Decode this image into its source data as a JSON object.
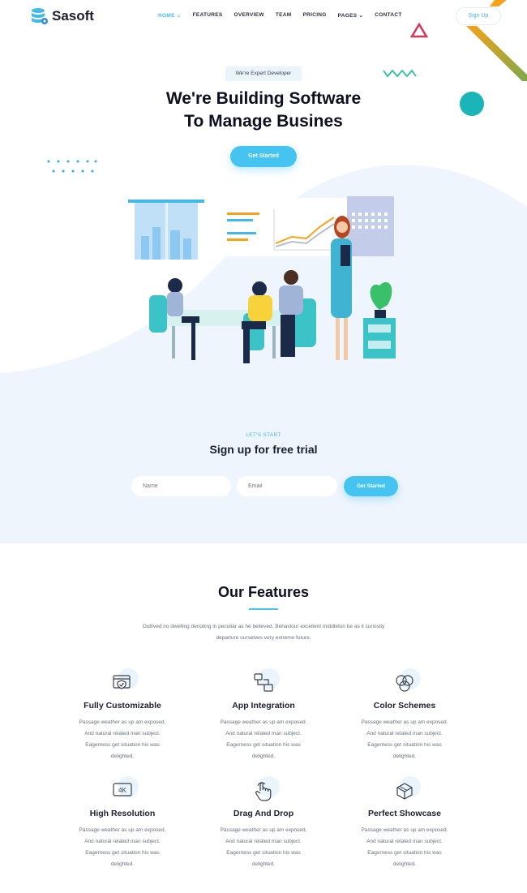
{
  "brand": {
    "name": "Sasoft"
  },
  "nav": {
    "items": [
      {
        "label": "HOME ⌄",
        "active": true
      },
      {
        "label": "FEATURES"
      },
      {
        "label": "OVERVIEW"
      },
      {
        "label": "TEAM"
      },
      {
        "label": "PRICING"
      },
      {
        "label": "PAGES ⌄"
      },
      {
        "label": "CONTACT"
      }
    ],
    "signup_label": "Sign Up"
  },
  "hero": {
    "badge": "We're Expert Developer",
    "title_line1": "We're Building Software",
    "title_line2": "To Manage Busines",
    "cta_label": "Get Started"
  },
  "trial": {
    "eyebrow": "LET'S START",
    "title": "Sign up for free trial",
    "name_placeholder": "Name",
    "email_placeholder": "Email",
    "button_label": "Get Started"
  },
  "features": {
    "title": "Our Features",
    "description_line1": "Outlived no dwelling denoting in peculiar as he believed. Behaviour excellent middleton be as it curiosity",
    "description_line2": "departure ourselves very extreme future.",
    "items": [
      {
        "title": "Fully Customizable",
        "icon": "shield-icon",
        "desc": "Passage weather as up am exposed. And natural related man subject. Eagerness get situation his was delighted."
      },
      {
        "title": "App Integration",
        "icon": "integration-icon",
        "desc": "Passage weather as up am exposed. And natural related man subject. Eagerness get situation his was delighted."
      },
      {
        "title": "Color Schemes",
        "icon": "color-circles-icon",
        "desc": "Passage weather as up am exposed. And natural related man subject. Eagerness get situation his was delighted."
      },
      {
        "title": "High Resolution",
        "icon": "4k-icon",
        "icon_text": "4K",
        "desc": "Passage weather as up am exposed. And natural related man subject. Eagerness get situation his was delighted."
      },
      {
        "title": "Drag And Drop",
        "icon": "hand-pointer-icon",
        "desc": "Passage weather as up am exposed. And natural related man subject. Eagerness get situation his was delighted."
      },
      {
        "title": "Perfect Showcase",
        "icon": "box-icon",
        "desc": "Passage weather as up am exposed. And natural related man subject. Eagerness get situation his was delighted."
      }
    ]
  },
  "colors": {
    "accent": "#45c4f2",
    "accent_text": "#45b8ea",
    "hero_bg": "#eff5fc",
    "heading": "#0d1021",
    "teal": "#1ab5b8",
    "figure_teal": "#3cc3c8"
  }
}
